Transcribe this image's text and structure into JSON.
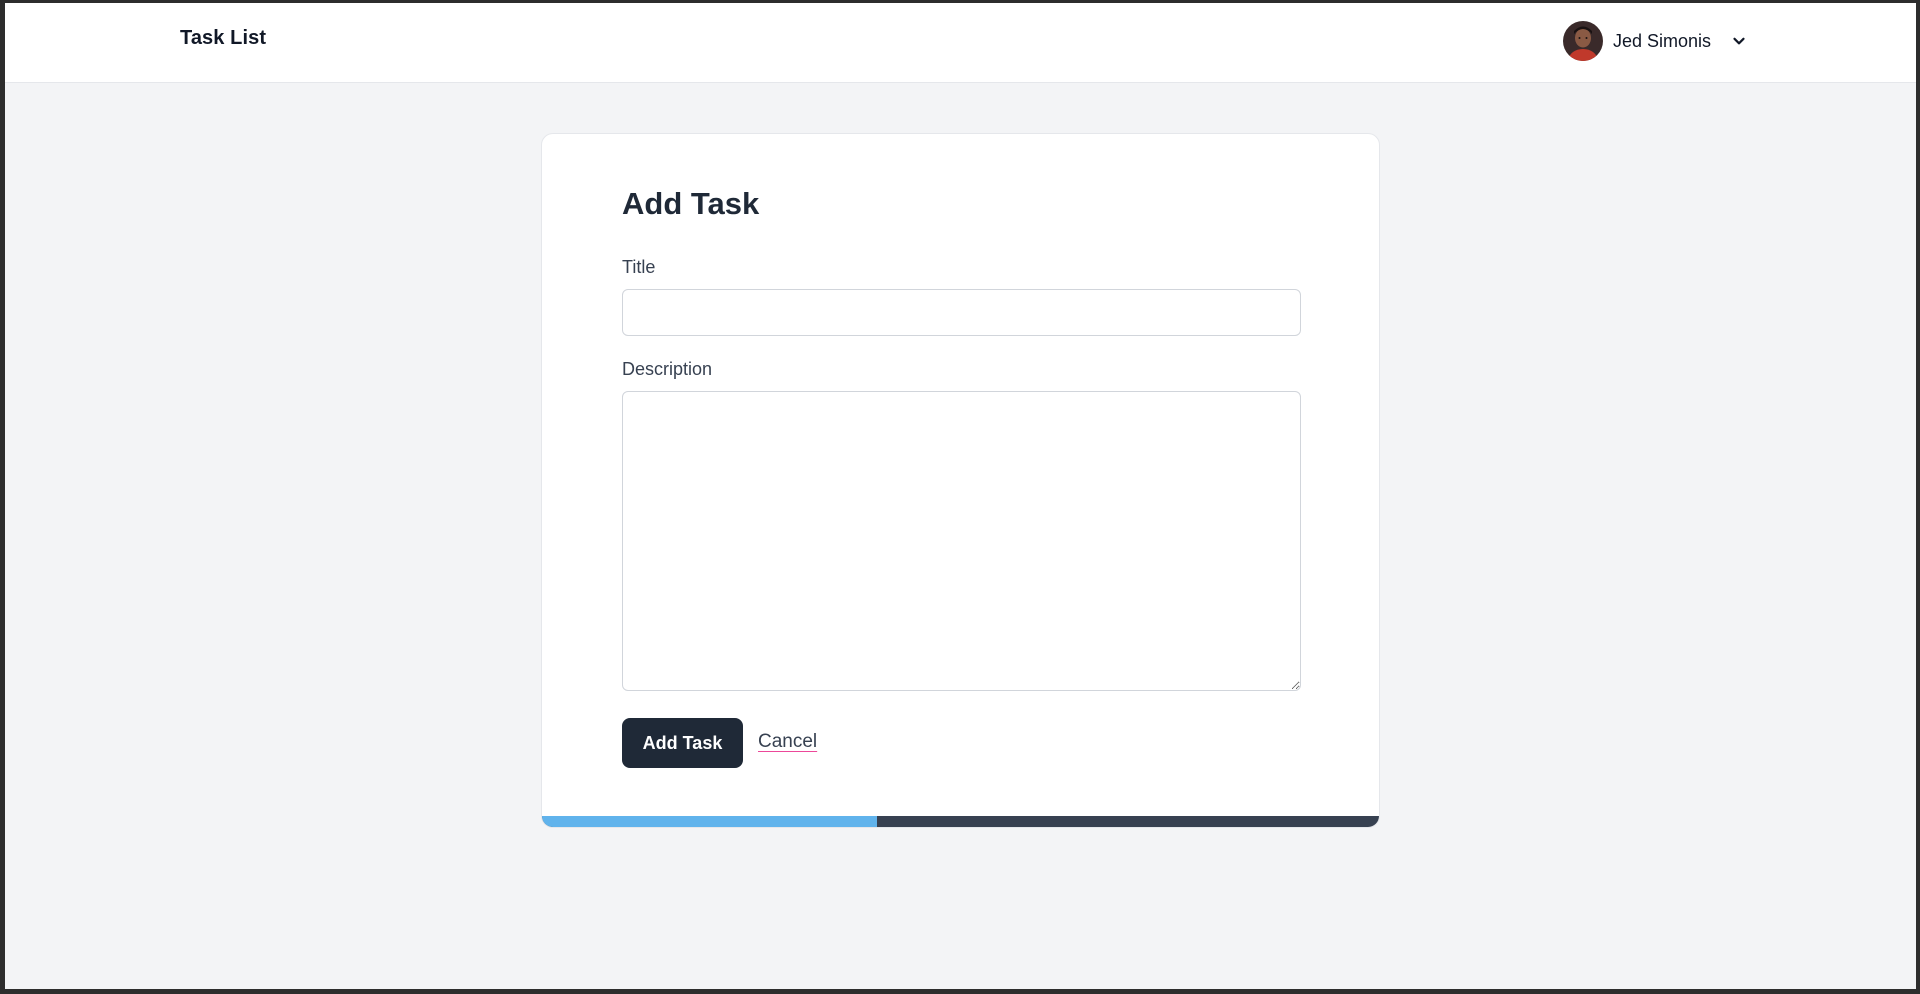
{
  "header": {
    "brand": "Task List",
    "user": {
      "name": "Jed Simonis",
      "avatar_icon": "user-avatar",
      "menu_icon": "chevron-down-icon"
    }
  },
  "form": {
    "heading": "Add Task",
    "title_field": {
      "label": "Title",
      "value": "",
      "placeholder": ""
    },
    "description_field": {
      "label": "Description",
      "value": "",
      "placeholder": ""
    },
    "submit_label": "Add Task",
    "cancel_label": "Cancel"
  },
  "progress": {
    "fraction": 0.4
  },
  "colors": {
    "primary_button": "#1f2937",
    "progress_fill": "#60b3ec",
    "progress_track": "#374151",
    "cancel_underline": "#ec4899",
    "page_background": "#f3f4f6"
  }
}
